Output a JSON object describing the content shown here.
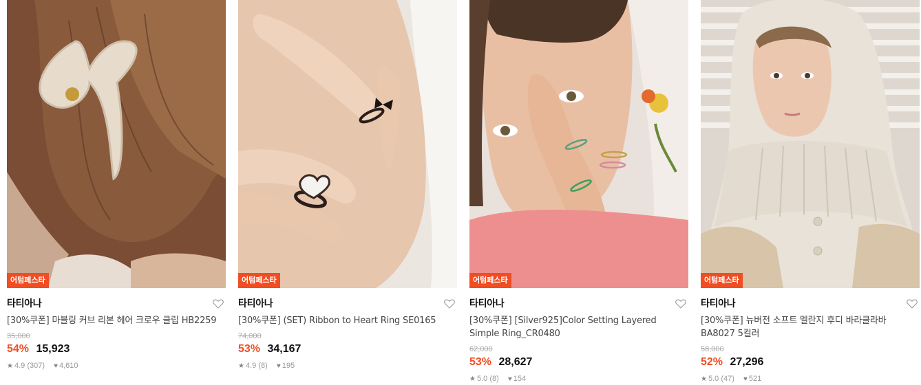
{
  "colors": {
    "badge": "#f04d23",
    "discount": "#f04d23",
    "text": "#222222",
    "muted": "#999999"
  },
  "products": [
    {
      "badge": "어텀페스타",
      "brand": "타티아나",
      "title": "[30%쿠폰] 마블링 커브 리본 헤어 크로우 클립 HB2259",
      "original_price": "35,000",
      "discount": "54%",
      "price": "15,923",
      "rating": "4.9 (307)",
      "likes": "4,610",
      "image": "hair-clip-photo"
    },
    {
      "badge": "어텀페스타",
      "brand": "타티아나",
      "title": "[30%쿠폰] (SET) Ribbon to Heart Ring SE0165",
      "original_price": "74,000",
      "discount": "53%",
      "price": "34,167",
      "rating": "4.9 (8)",
      "likes": "195",
      "image": "ring-hand-photo"
    },
    {
      "badge": "어텀페스타",
      "brand": "타티아나",
      "title": "[30%쿠폰] [Silver925]Color Setting Layered Simple Ring_CR0480",
      "original_price": "62,000",
      "discount": "53%",
      "price": "28,627",
      "rating": "5.0 (8)",
      "likes": "154",
      "image": "face-rings-photo"
    },
    {
      "badge": "어텀페스타",
      "brand": "타티아나",
      "title": "[30%쿠폰] 뉴버전 소프트 멜란지 후디 바라클라바 BA8027 5컬러",
      "original_price": "58,000",
      "discount": "52%",
      "price": "27,296",
      "rating": "5.0 (47)",
      "likes": "521",
      "image": "knit-balaclava-photo"
    }
  ]
}
